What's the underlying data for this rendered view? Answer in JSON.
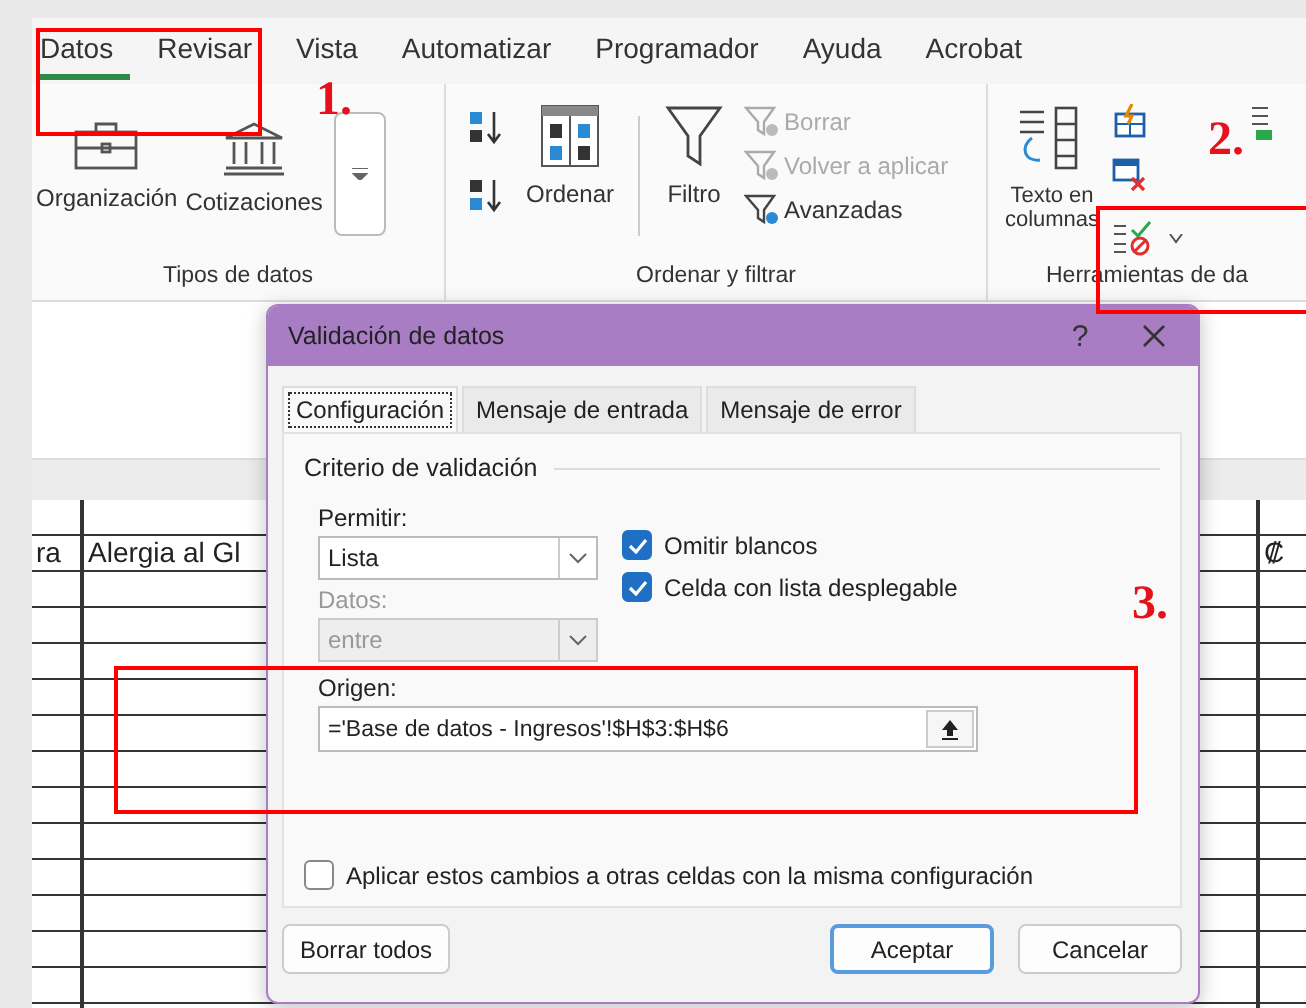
{
  "menu_tabs": [
    {
      "label": "Datos",
      "selected": true
    },
    {
      "label": "Revisar",
      "selected": false
    },
    {
      "label": "Vista",
      "selected": false
    },
    {
      "label": "Automatizar",
      "selected": false
    },
    {
      "label": "Programador",
      "selected": false
    },
    {
      "label": "Ayuda",
      "selected": false
    },
    {
      "label": "Acrobat",
      "selected": false
    }
  ],
  "ribbon": {
    "data_types": {
      "title": "Tipos de datos",
      "buttons": [
        "Organización",
        "Cotizaciones"
      ]
    },
    "sort_filter": {
      "title": "Ordenar y filtrar",
      "sort_label": "Ordenar",
      "filter_label": "Filtro",
      "filter_actions": [
        {
          "label": "Borrar",
          "disabled": true
        },
        {
          "label": "Volver a aplicar",
          "disabled": true
        },
        {
          "label": "Avanzadas",
          "disabled": false
        }
      ]
    },
    "data_tools": {
      "title": "Herramientas de da",
      "text_to_columns": "Texto en columnas"
    }
  },
  "sheet": {
    "cells": [
      "ra",
      "Alergia al Gl"
    ],
    "right_cell": "₡"
  },
  "dialog": {
    "title": "Validación de datos",
    "help": "?",
    "tabs": [
      {
        "label": "Configuración",
        "selected": true
      },
      {
        "label": "Mensaje de entrada",
        "selected": false
      },
      {
        "label": "Mensaje de error",
        "selected": false
      }
    ],
    "section": "Criterio de validación",
    "allow_label": "Permitir:",
    "allow_value": "Lista",
    "options": [
      {
        "label": "Omitir blancos",
        "checked": true
      },
      {
        "label": "Celda con lista desplegable",
        "checked": true
      }
    ],
    "data_label": "Datos:",
    "data_value": "entre",
    "data_disabled": true,
    "source_label": "Origen:",
    "source_value": "='Base de datos - Ingresos'!$H$3:$H$6",
    "apply_all": {
      "label": "Aplicar estos cambios a otras celdas con la misma configuración",
      "checked": false
    },
    "buttons": {
      "clear": "Borrar todos",
      "ok": "Aceptar",
      "cancel": "Cancelar"
    }
  },
  "annotations": [
    {
      "label": "1."
    },
    {
      "label": "2."
    },
    {
      "label": "3."
    }
  ]
}
